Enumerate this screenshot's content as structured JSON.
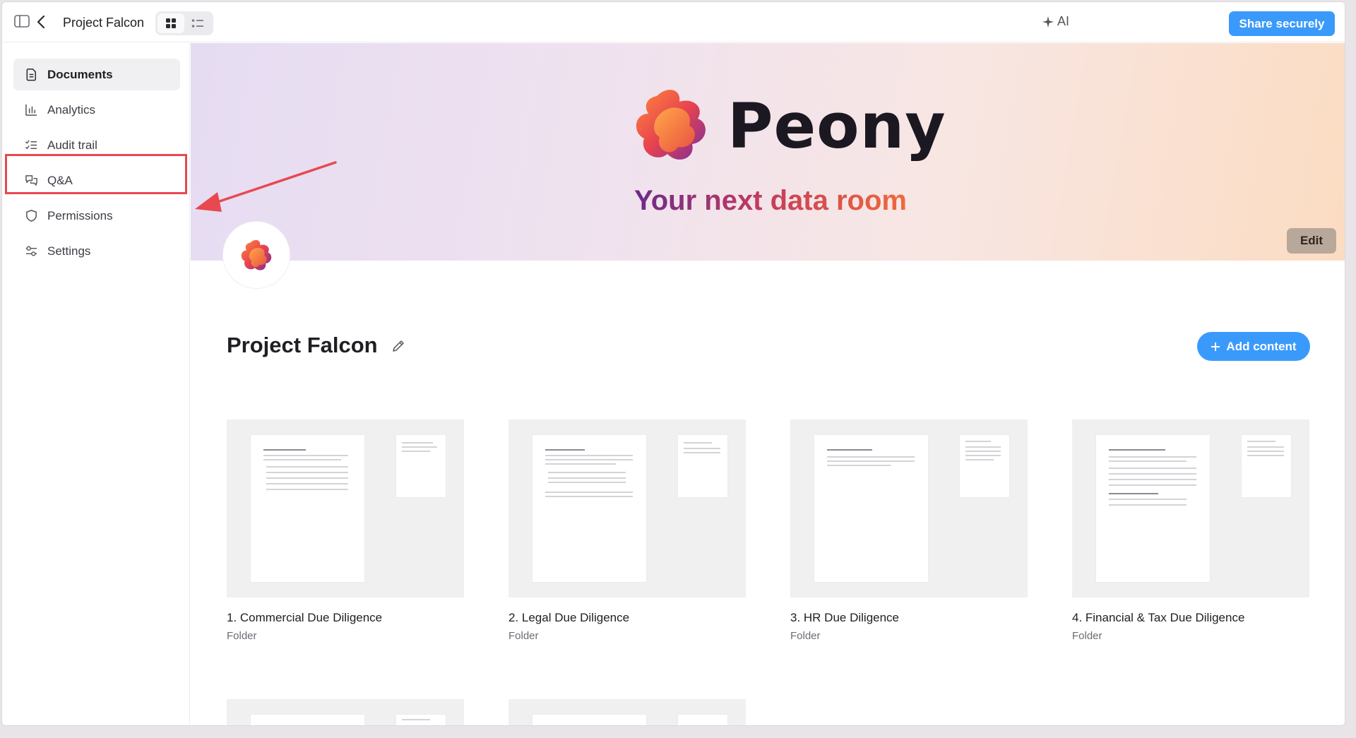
{
  "topbar": {
    "title": "Project Falcon",
    "ai_label": "AI",
    "share_label": "Share securely"
  },
  "sidebar": {
    "items": [
      {
        "label": "Documents",
        "icon": "document-icon",
        "active": true
      },
      {
        "label": "Analytics",
        "icon": "bar-chart-icon",
        "active": false
      },
      {
        "label": "Audit trail",
        "icon": "checklist-icon",
        "active": false
      },
      {
        "label": "Q&A",
        "icon": "chat-bubbles-icon",
        "active": false
      },
      {
        "label": "Permissions",
        "icon": "shield-icon",
        "active": false
      },
      {
        "label": "Settings",
        "icon": "sliders-icon",
        "active": false
      }
    ]
  },
  "banner": {
    "brand": "Peony",
    "tagline": "Your next data room",
    "edit_label": "Edit"
  },
  "main": {
    "title": "Project Falcon",
    "add_label": "Add content",
    "folders": [
      {
        "name": "1. Commercial Due Diligence",
        "type": "Folder"
      },
      {
        "name": "2. Legal Due Diligence",
        "type": "Folder"
      },
      {
        "name": "3. HR Due Diligence",
        "type": "Folder"
      },
      {
        "name": "4. Financial & Tax Due Diligence",
        "type": "Folder"
      }
    ]
  },
  "colors": {
    "accent": "#3a9afb",
    "annotation": "#e8484f",
    "edit_button": "#b8a89a"
  }
}
